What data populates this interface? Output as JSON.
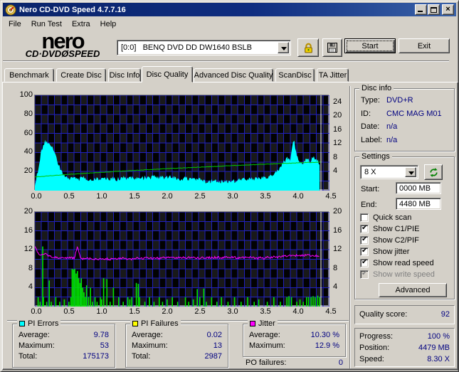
{
  "window": {
    "title": "Nero CD-DVD Speed 4.7.7.16"
  },
  "titlebar_buttons": {
    "minimize": "minimize",
    "maximize": "maximize",
    "close": "close"
  },
  "menu": {
    "items": [
      "File",
      "Run Test",
      "Extra",
      "Help"
    ]
  },
  "toolbar": {
    "logo_line1": "nero",
    "logo_line2": "CD·DVDØSPEED",
    "drive_value": "[0:0]   BENQ DVD DD DW1640 BSLB",
    "start_label": "Start",
    "exit_label": "Exit",
    "icons": {
      "lock_button": "lock-icon",
      "save_button": "save-floppy-icon",
      "drive_dropdown": "chevron-down-icon"
    }
  },
  "tabs": {
    "items": [
      "Benchmark",
      "Create Disc",
      "Disc Info",
      "Disc Quality",
      "Advanced Disc Quality",
      "ScanDisc",
      "TA Jitter"
    ],
    "active": "Disc Quality"
  },
  "disc_info": {
    "title": "Disc info",
    "rows": [
      {
        "label": "Type:",
        "value": "DVD+R"
      },
      {
        "label": "ID:",
        "value": "CMC MAG M01"
      },
      {
        "label": "Date:",
        "value": "n/a"
      },
      {
        "label": "Label:",
        "value": "n/a"
      }
    ]
  },
  "settings": {
    "title": "Settings",
    "speed_value": "8 X",
    "refresh_icon": "refresh-arrows-icon",
    "start_label": "Start:",
    "start_value": "0000 MB",
    "end_label": "End:",
    "end_value": "4480 MB",
    "checkboxes": [
      {
        "label": "Quick scan",
        "checked": false,
        "enabled": true
      },
      {
        "label": "Show C1/PIE",
        "checked": true,
        "enabled": true
      },
      {
        "label": "Show C2/PIF",
        "checked": true,
        "enabled": true
      },
      {
        "label": "Show jitter",
        "checked": true,
        "enabled": true
      },
      {
        "label": "Show read speed",
        "checked": true,
        "enabled": true
      },
      {
        "label": "Show write speed",
        "checked": true,
        "enabled": false
      }
    ],
    "advanced_label": "Advanced"
  },
  "quality": {
    "label": "Quality score:",
    "value": "92"
  },
  "progress": {
    "rows": [
      {
        "label": "Progress:",
        "value": "100 %"
      },
      {
        "label": "Position:",
        "value": "4479 MB"
      },
      {
        "label": "Speed:",
        "value": "8.30 X"
      }
    ]
  },
  "stats": [
    {
      "key": "pi_errors",
      "title": "PI Errors",
      "swatch": "#00FFFF",
      "rows": [
        {
          "label": "Average:",
          "value": "9.78"
        },
        {
          "label": "Maximum:",
          "value": "53"
        },
        {
          "label": "Total:",
          "value": "175173"
        }
      ]
    },
    {
      "key": "pi_failures",
      "title": "PI Failures",
      "swatch": "#FFFF00",
      "rows": [
        {
          "label": "Average:",
          "value": "0.02"
        },
        {
          "label": "Maximum:",
          "value": "13"
        },
        {
          "label": "Total:",
          "value": "2987"
        }
      ]
    },
    {
      "key": "jitter",
      "title": "Jitter",
      "swatch": "#FF00FF",
      "rows": [
        {
          "label": "Average:",
          "value": "10.30 %"
        },
        {
          "label": "Maximum:",
          "value": "12.9 %"
        }
      ]
    }
  ],
  "po_failures": {
    "label": "PO failures:",
    "value": "0"
  },
  "chart_data": [
    {
      "type": "area",
      "title": "PI Errors (cyan area, left axis) and read speed (green line, right axis)",
      "x_range": [
        0,
        4.5
      ],
      "x_grid_step": 0.1,
      "x_ticks": [
        "0.0",
        "0.5",
        "1.0",
        "1.5",
        "2.0",
        "2.5",
        "3.0",
        "3.5",
        "4.0",
        "4.5"
      ],
      "y_left": {
        "range": [
          0,
          100
        ],
        "grid_step": 10,
        "ticks": [
          {
            "v": 100,
            "label": "100"
          },
          {
            "v": 80,
            "label": "80"
          },
          {
            "v": 60,
            "label": "60"
          },
          {
            "v": 40,
            "label": "40"
          },
          {
            "v": 20,
            "label": "20"
          }
        ]
      },
      "y_right": {
        "unit": "X speed",
        "ticks": [
          {
            "v": 92.5,
            "label": "24"
          },
          {
            "v": 78,
            "label": "20"
          },
          {
            "v": 63.5,
            "label": "16"
          },
          {
            "v": 49,
            "label": "12"
          },
          {
            "v": 34.5,
            "label": "8"
          },
          {
            "v": 20,
            "label": "4"
          }
        ]
      },
      "marker_x": 4.37,
      "grid_color": "#2020BF",
      "marker_color": "#FFFFFF",
      "series": [
        {
          "name": "pi_errors",
          "kind": "area",
          "color": "#00FFFF",
          "noise": 2.2,
          "x0": 0,
          "dx": 0.05,
          "values": [
            5,
            20,
            40,
            50,
            48,
            45,
            41,
            28,
            20,
            15,
            13,
            12,
            13,
            11,
            12,
            13,
            11,
            10,
            11,
            12,
            11,
            13,
            12,
            11,
            12,
            10,
            12,
            13,
            11,
            12,
            13,
            12,
            14,
            12,
            13,
            12,
            14,
            13,
            12,
            13,
            13,
            14,
            12,
            13,
            12,
            11,
            13,
            11,
            12,
            10,
            11,
            10,
            9,
            10,
            9,
            10,
            9,
            8,
            10,
            9,
            10,
            9,
            11,
            10,
            12,
            11,
            12,
            11,
            13,
            12,
            13,
            13,
            15,
            16,
            19,
            23,
            30,
            33,
            31,
            53,
            36,
            30,
            28,
            33,
            30,
            34,
            31,
            27
          ]
        },
        {
          "name": "read_speed",
          "kind": "line",
          "color": "#00C800",
          "noise": 0.25,
          "points": [
            [
              0,
              14.4
            ],
            [
              0.5,
              16.9
            ],
            [
              1.0,
              19.2
            ],
            [
              1.5,
              21.1
            ],
            [
              2.0,
              23.0
            ],
            [
              2.5,
              24.6
            ],
            [
              3.0,
              26.2
            ],
            [
              3.5,
              27.7
            ],
            [
              4.0,
              29.1
            ],
            [
              4.37,
              30.0
            ]
          ]
        }
      ]
    },
    {
      "type": "bar",
      "title": "PI Failures (green bars) and jitter % (magenta line)",
      "x_range": [
        0,
        4.5
      ],
      "x_grid_step": 0.1,
      "x_ticks": [
        "0.0",
        "0.5",
        "1.0",
        "1.5",
        "2.0",
        "2.5",
        "3.0",
        "3.5",
        "4.0",
        "4.5"
      ],
      "y_left": {
        "range": [
          0,
          20
        ],
        "grid_step": 2,
        "ticks": [
          {
            "v": 20,
            "label": "20"
          },
          {
            "v": 16,
            "label": "16"
          },
          {
            "v": 12,
            "label": "12"
          },
          {
            "v": 8,
            "label": "8"
          },
          {
            "v": 4,
            "label": "4"
          }
        ]
      },
      "y_right": {
        "unit": "same as left",
        "ticks": [
          {
            "v": 20,
            "label": "20"
          },
          {
            "v": 16,
            "label": "16"
          },
          {
            "v": 12,
            "label": "12"
          },
          {
            "v": 8,
            "label": "8"
          },
          {
            "v": 4,
            "label": "4"
          }
        ]
      },
      "marker_x": 4.37,
      "grid_color": "#2020BF",
      "marker_color": "#FFFFFF",
      "series": [
        {
          "name": "pi_failures",
          "kind": "bars",
          "color": "#00E400",
          "bars": [
            [
              0.05,
              2
            ],
            [
              0.08,
              1
            ],
            [
              0.12,
              12.7
            ],
            [
              0.13,
              2
            ],
            [
              0.18,
              1
            ],
            [
              0.22,
              5.5
            ],
            [
              0.25,
              1
            ],
            [
              0.32,
              2
            ],
            [
              0.38,
              1
            ],
            [
              0.45,
              1.5
            ],
            [
              0.52,
              1
            ],
            [
              0.55,
              2
            ],
            [
              0.57,
              8
            ],
            [
              0.59,
              7.8
            ],
            [
              0.61,
              8
            ],
            [
              0.63,
              7
            ],
            [
              0.65,
              7.5
            ],
            [
              0.67,
              6
            ],
            [
              0.69,
              5
            ],
            [
              0.71,
              6
            ],
            [
              0.73,
              4
            ],
            [
              0.75,
              3
            ],
            [
              0.77,
              2
            ],
            [
              0.79,
              4.5
            ],
            [
              0.82,
              2
            ],
            [
              0.85,
              4
            ],
            [
              0.88,
              1
            ],
            [
              0.92,
              2
            ],
            [
              0.95,
              1
            ],
            [
              1.0,
              2
            ],
            [
              1.02,
              1.5
            ],
            [
              1.05,
              6
            ],
            [
              1.1,
              5.8
            ],
            [
              1.15,
              1
            ],
            [
              1.2,
              4
            ],
            [
              1.28,
              2
            ],
            [
              1.35,
              1
            ],
            [
              1.42,
              2
            ],
            [
              1.45,
              1.5
            ],
            [
              1.48,
              2
            ],
            [
              1.55,
              5
            ],
            [
              1.58,
              4.8
            ],
            [
              1.6,
              2
            ],
            [
              1.68,
              1
            ],
            [
              1.75,
              2
            ],
            [
              1.82,
              1
            ],
            [
              1.9,
              2
            ],
            [
              1.95,
              1
            ],
            [
              2.02,
              1.5
            ],
            [
              2.1,
              2
            ],
            [
              2.18,
              1
            ],
            [
              2.3,
              2
            ],
            [
              2.35,
              1
            ],
            [
              2.42,
              1.5
            ],
            [
              2.48,
              3.7
            ],
            [
              2.52,
              2
            ],
            [
              2.58,
              3.8
            ],
            [
              2.62,
              1
            ],
            [
              2.7,
              2
            ],
            [
              2.78,
              1
            ],
            [
              2.85,
              2
            ],
            [
              2.95,
              1
            ],
            [
              3.05,
              2
            ],
            [
              3.15,
              1
            ],
            [
              3.25,
              2
            ],
            [
              3.35,
              1
            ],
            [
              3.42,
              1.5
            ],
            [
              3.55,
              1
            ],
            [
              3.65,
              2
            ],
            [
              3.75,
              1
            ],
            [
              3.85,
              2
            ],
            [
              3.88,
              2.2
            ],
            [
              3.92,
              2
            ],
            [
              4.0,
              1
            ],
            [
              4.05,
              1.5
            ],
            [
              4.1,
              1
            ],
            [
              4.15,
              2
            ],
            [
              4.18,
              2
            ],
            [
              4.22,
              2
            ],
            [
              4.25,
              2.2
            ],
            [
              4.28,
              2
            ],
            [
              4.32,
              2.3
            ],
            [
              4.35,
              2
            ]
          ]
        },
        {
          "name": "jitter",
          "kind": "line",
          "color": "#FF00FF",
          "noise": 0.22,
          "x0": 0,
          "dx": 0.05,
          "values": [
            12.9,
            11.2,
            11.0,
            11.3,
            10.8,
            10.5,
            10.4,
            10.3,
            10.3,
            10.2,
            10.2,
            10.3,
            10.2,
            12.6,
            10.2,
            10.1,
            10.2,
            10.1,
            10.0,
            10.1,
            10.1,
            10.2,
            10.1,
            10.0,
            10.1,
            10.0,
            10.1,
            10.2,
            10.1,
            10.0,
            10.1,
            10.2,
            10.3,
            10.2,
            10.2,
            10.3,
            10.2,
            10.3,
            10.2,
            10.3,
            10.3,
            10.4,
            10.3,
            10.4,
            10.3,
            10.4,
            10.3,
            10.4,
            10.4,
            10.3,
            10.2,
            10.4,
            10.3,
            10.4,
            10.3,
            10.4,
            10.4,
            10.3,
            10.4,
            10.3,
            10.4,
            10.4,
            10.3,
            10.4,
            10.4,
            10.5,
            10.4,
            10.3,
            10.2,
            10.3,
            10.2,
            10.4,
            10.4,
            10.5,
            10.5,
            10.6,
            10.6,
            10.7,
            10.9,
            10.8,
            10.8,
            10.7,
            10.8,
            10.9,
            10.8,
            10.9,
            10.8,
            10.6
          ]
        }
      ]
    }
  ]
}
